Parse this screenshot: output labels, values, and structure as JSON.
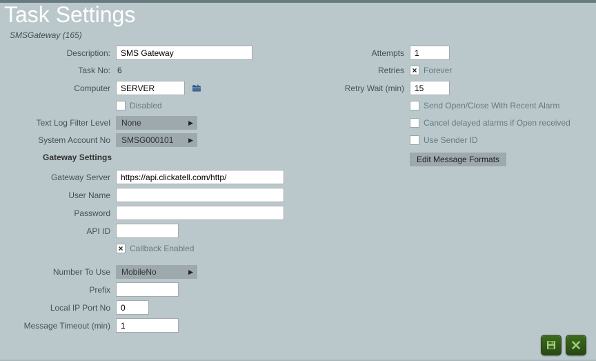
{
  "header": {
    "title": "Task Settings",
    "breadcrumb": "SMSGateway (165)"
  },
  "left": {
    "description_label": "Description:",
    "description_value": "SMS Gateway",
    "taskno_label": "Task No:",
    "taskno_value": "6",
    "computer_label": "Computer",
    "computer_value": "SERVER",
    "disabled_label": "Disabled",
    "disabled_checked": false,
    "textlog_label": "Text Log Filter Level",
    "textlog_value": "None",
    "sysacct_label": "System Account No",
    "sysacct_value": "SMSG000101",
    "gateway_heading": "Gateway Settings",
    "gserver_label": "Gateway Server",
    "gserver_value": "https://api.clickatell.com/http/",
    "username_label": "User Name",
    "username_value": "",
    "password_label": "Password",
    "password_value": "",
    "apiid_label": "API ID",
    "apiid_value": "",
    "callback_label": "Callback Enabled",
    "callback_checked": true,
    "numbertouse_label": "Number To Use",
    "numbertouse_value": "MobileNo",
    "prefix_label": "Prefix",
    "prefix_value": "",
    "localip_label": "Local IP Port No",
    "localip_value": "0",
    "msgtimeout_label": "Message Timeout (min)",
    "msgtimeout_value": "1"
  },
  "right": {
    "attempts_label": "Attempts",
    "attempts_value": "1",
    "retries_label": "Retries",
    "retries_text": "Forever",
    "retries_checked": true,
    "retrywait_label": "Retry Wait (min)",
    "retrywait_value": "15",
    "sendopen_label": "Send Open/Close With Recent Alarm",
    "sendopen_checked": false,
    "canceldelayed_label": "Cancel delayed alarms if Open received",
    "canceldelayed_checked": false,
    "usesender_label": "Use Sender ID",
    "usesender_checked": false,
    "editformats_label": "Edit Message Formats"
  }
}
